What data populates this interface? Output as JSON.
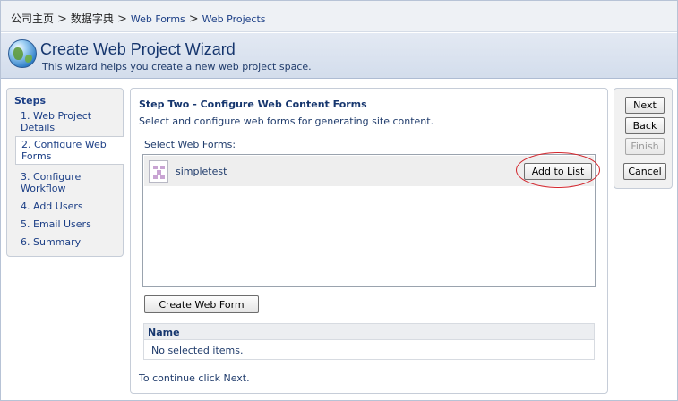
{
  "breadcrumb": {
    "items": [
      "公司主页",
      "数据字典",
      "Web Forms",
      "Web Projects"
    ],
    "separator": ">"
  },
  "header": {
    "title": "Create Web Project Wizard",
    "subtitle": "This wizard helps you create a new web project space.",
    "icon": "globe-icon"
  },
  "steps": {
    "heading": "Steps",
    "items": [
      {
        "label": "1. Web Project Details"
      },
      {
        "label": "2. Configure Web Forms"
      },
      {
        "label": "3. Configure Workflow"
      },
      {
        "label": "4. Add Users"
      },
      {
        "label": "5. Email Users"
      },
      {
        "label": "6. Summary"
      }
    ],
    "active_index": 1
  },
  "main": {
    "title": "Step Two - Configure Web Content Forms",
    "description": "Select and configure web forms for generating site content.",
    "select_label": "Select Web Forms:",
    "forms": [
      {
        "name": "simpletest",
        "icon": "web-form-icon",
        "action_label": "Add to List"
      }
    ],
    "create_button": "Create Web Form",
    "selected_table": {
      "header": "Name",
      "empty_text": "No selected items."
    },
    "continue_text": "To continue click Next."
  },
  "nav": {
    "next": "Next",
    "back": "Back",
    "finish": "Finish",
    "cancel": "Cancel"
  },
  "colors": {
    "accent": "#16366e",
    "highlight_ring": "#d2232a"
  }
}
